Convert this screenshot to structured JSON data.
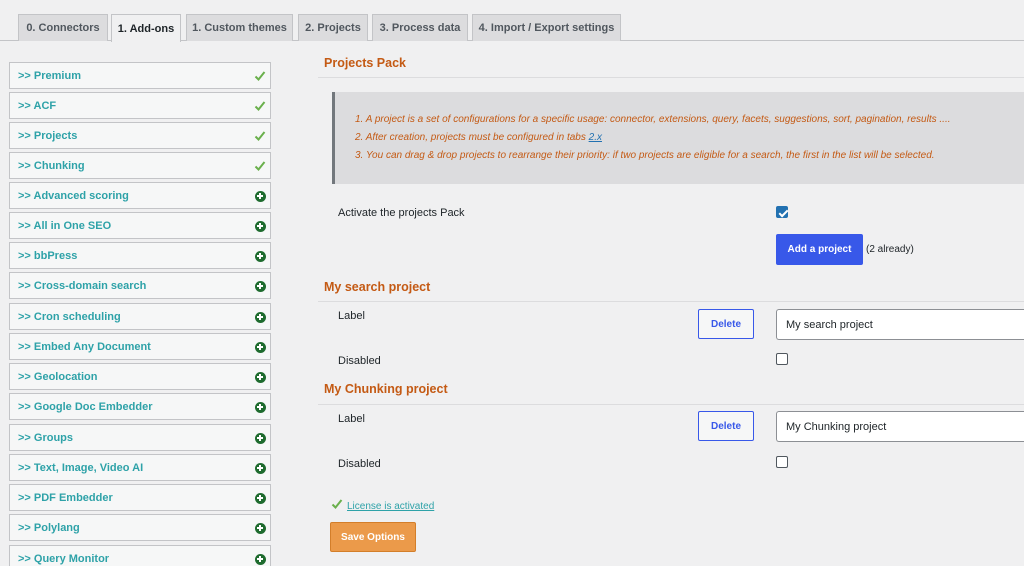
{
  "tabs": [
    {
      "label": "0. Connectors",
      "active": false
    },
    {
      "label": "1. Add-ons",
      "active": true
    },
    {
      "label": "1. Custom themes",
      "active": false
    },
    {
      "label": "2. Projects",
      "active": false
    },
    {
      "label": "3. Process data",
      "active": false
    },
    {
      "label": "4. Import / Export settings",
      "active": false
    }
  ],
  "sidebar": {
    "items": [
      {
        "label": ">> Premium",
        "status": "check-icon"
      },
      {
        "label": ">> ACF",
        "status": "check-icon"
      },
      {
        "label": ">> Projects",
        "status": "check-icon"
      },
      {
        "label": ">> Chunking",
        "status": "check-icon"
      },
      {
        "label": ">> Advanced scoring",
        "status": "plus-icon"
      },
      {
        "label": ">> All in One SEO",
        "status": "plus-icon"
      },
      {
        "label": ">> bbPress",
        "status": "plus-icon"
      },
      {
        "label": ">> Cross-domain search",
        "status": "plus-icon"
      },
      {
        "label": ">> Cron scheduling",
        "status": "plus-icon"
      },
      {
        "label": ">> Embed Any Document",
        "status": "plus-icon"
      },
      {
        "label": ">> Geolocation",
        "status": "plus-icon"
      },
      {
        "label": ">> Google Doc Embedder",
        "status": "plus-icon"
      },
      {
        "label": ">> Groups",
        "status": "plus-icon"
      },
      {
        "label": ">> Text, Image, Video AI",
        "status": "plus-icon"
      },
      {
        "label": ">> PDF Embedder",
        "status": "plus-icon"
      },
      {
        "label": ">> Polylang",
        "status": "plus-icon"
      },
      {
        "label": ">> Query Monitor",
        "status": "plus-icon"
      }
    ]
  },
  "main": {
    "pack_title": "Projects Pack",
    "notice": {
      "line1": "1. A project is a set of configurations for a specific usage: connector, extensions, query, facets, suggestions, sort, pagination, results ....",
      "line2_prefix": "2. After creation, projects must be configured in tabs",
      "line2_link": "2.x",
      "line3": "3. You can drag & drop projects to rearrange their priority: if two projects are eligible for a search, the first in the list will be selected."
    },
    "activate_label": "Activate the projects Pack",
    "activate_checked": true,
    "add_project_label": "Add a project",
    "already_count": "(2 already)",
    "projects": [
      {
        "title": "My search project",
        "label_text": "Label",
        "delete_label": "Delete",
        "value": "My search project",
        "disabled_label": "Disabled",
        "disabled_checked": false
      },
      {
        "title": "My Chunking project",
        "label_text": "Label",
        "delete_label": "Delete",
        "value": "My Chunking project",
        "disabled_label": "Disabled",
        "disabled_checked": false
      }
    ],
    "license_text": "License is activated",
    "save_label": "Save Options"
  },
  "colors": {
    "accent_orange": "#c45a14",
    "teal": "#2ea2a8",
    "primary_blue": "#3858e9",
    "check_green": "#6ab04c",
    "plus_green": "#1e6b2e",
    "save_orange": "#eb9a4a"
  }
}
